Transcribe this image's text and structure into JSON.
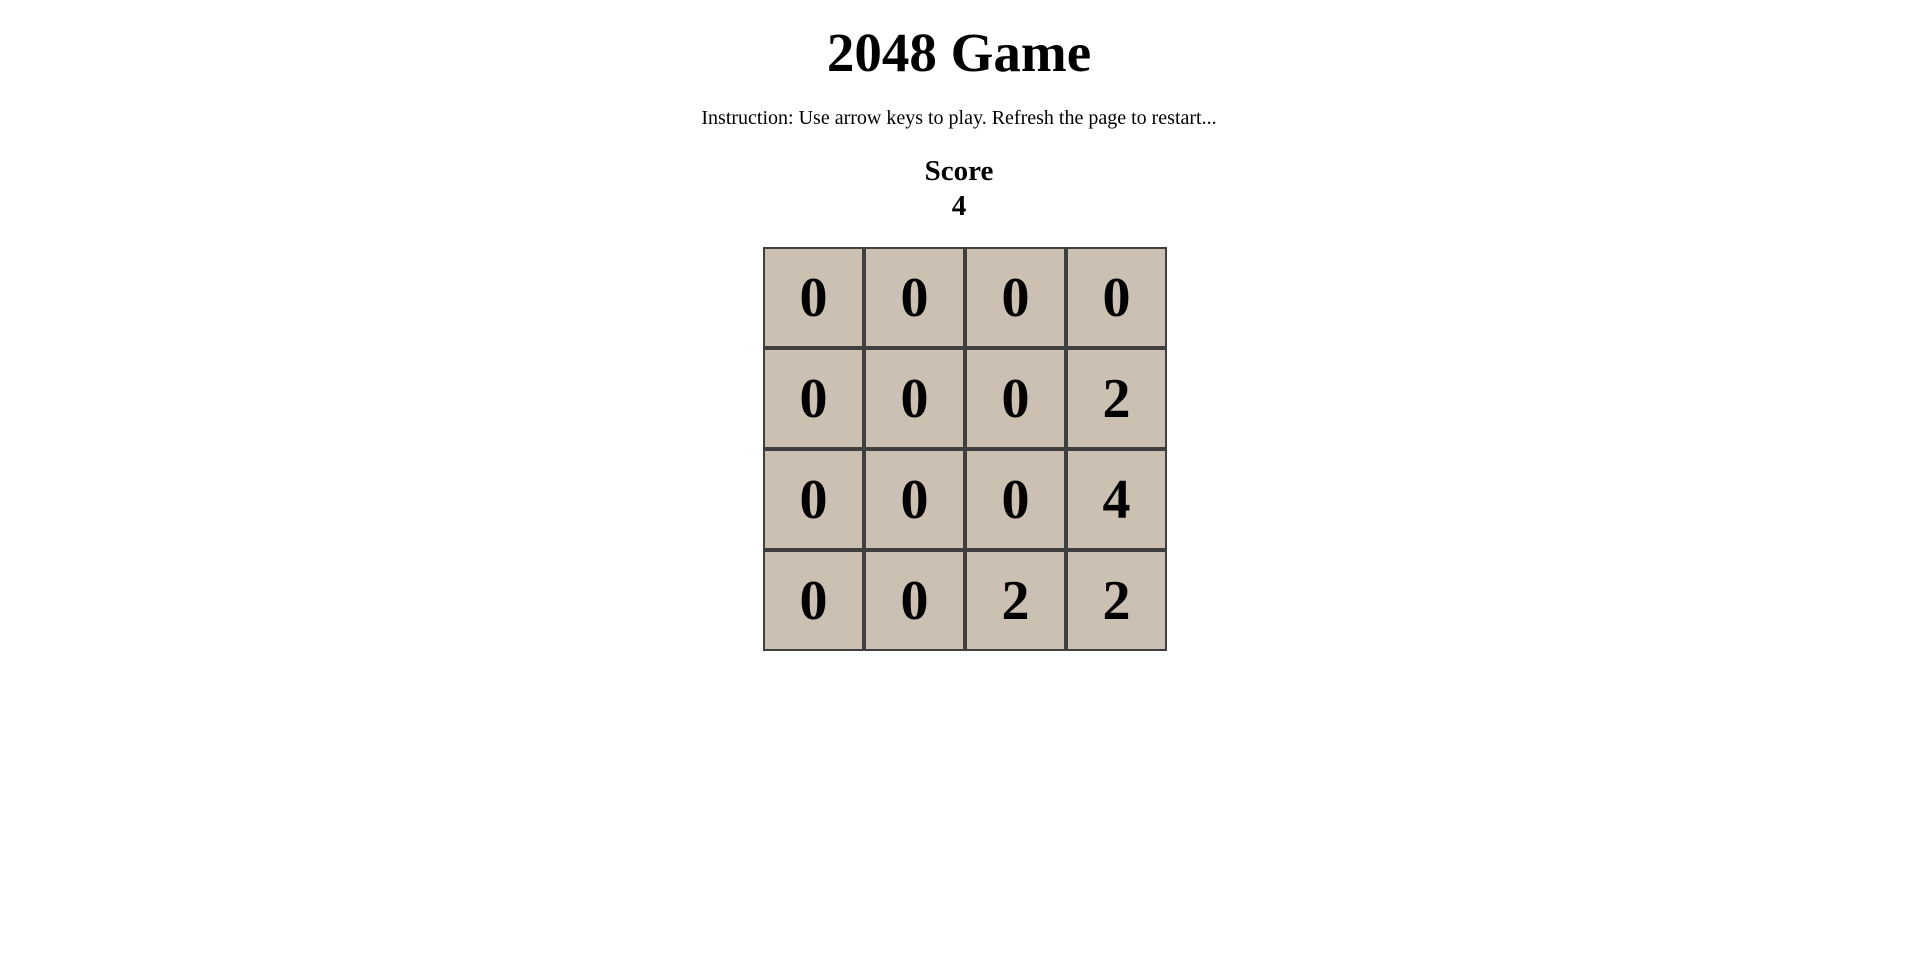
{
  "title": "2048 Game",
  "instruction": "Instruction: Use arrow keys to play. Refresh the page to restart...",
  "score": {
    "label": "Score",
    "value": "4"
  },
  "board": {
    "rows": [
      [
        "0",
        "0",
        "0",
        "0"
      ],
      [
        "0",
        "0",
        "0",
        "2"
      ],
      [
        "0",
        "0",
        "0",
        "4"
      ],
      [
        "0",
        "0",
        "2",
        "2"
      ]
    ]
  },
  "colors": {
    "tile_background": "#ccc0b3",
    "tile_border": "#3f3f3f",
    "page_background": "#ffffff",
    "text": "#000000"
  }
}
